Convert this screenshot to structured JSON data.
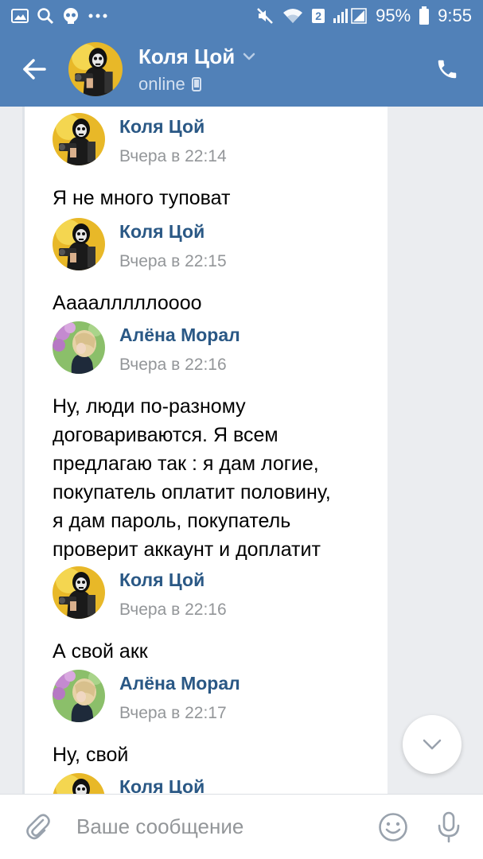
{
  "status_bar": {
    "left_icons": [
      "image-icon",
      "search-icon",
      "skull-icon",
      "more-dots-icon"
    ],
    "sim_badge": "2",
    "battery": "95%",
    "time": "9:55"
  },
  "header": {
    "name": "Коля Цой",
    "status": "online"
  },
  "messages": [
    {
      "author": "Коля Цой",
      "time": "Вчера в 22:14",
      "text": "Я не много туповат",
      "avatar": "kolya"
    },
    {
      "author": "Коля Цой",
      "time": "Вчера в 22:15",
      "text": "Аааалллллоооо",
      "avatar": "kolya"
    },
    {
      "author": "Алёна Морал",
      "time": "Вчера в 22:16",
      "text": "Ну, люди по-разному\nдоговариваются. Я всем\nпредлагаю так : я дам логие,\nпокупатель оплатит половину,\nя дам пароль, покупатель\nпроверит аккаунт и доплатит",
      "avatar": "alena"
    },
    {
      "author": "Коля Цой",
      "time": "Вчера в 22:16",
      "text": "А свой акк",
      "avatar": "kolya"
    },
    {
      "author": "Алёна Морал",
      "time": "Вчера в 22:17",
      "text": "Ну, свой",
      "avatar": "alena"
    },
    {
      "author": "Коля Цой",
      "time": "",
      "text": "",
      "avatar": "kolya"
    }
  ],
  "composer": {
    "placeholder": "Ваше сообщение"
  },
  "colors": {
    "header_bg": "#5181b8",
    "name_link": "#2a5885",
    "time_gray": "#939699",
    "chat_bg": "#ebedf0"
  }
}
